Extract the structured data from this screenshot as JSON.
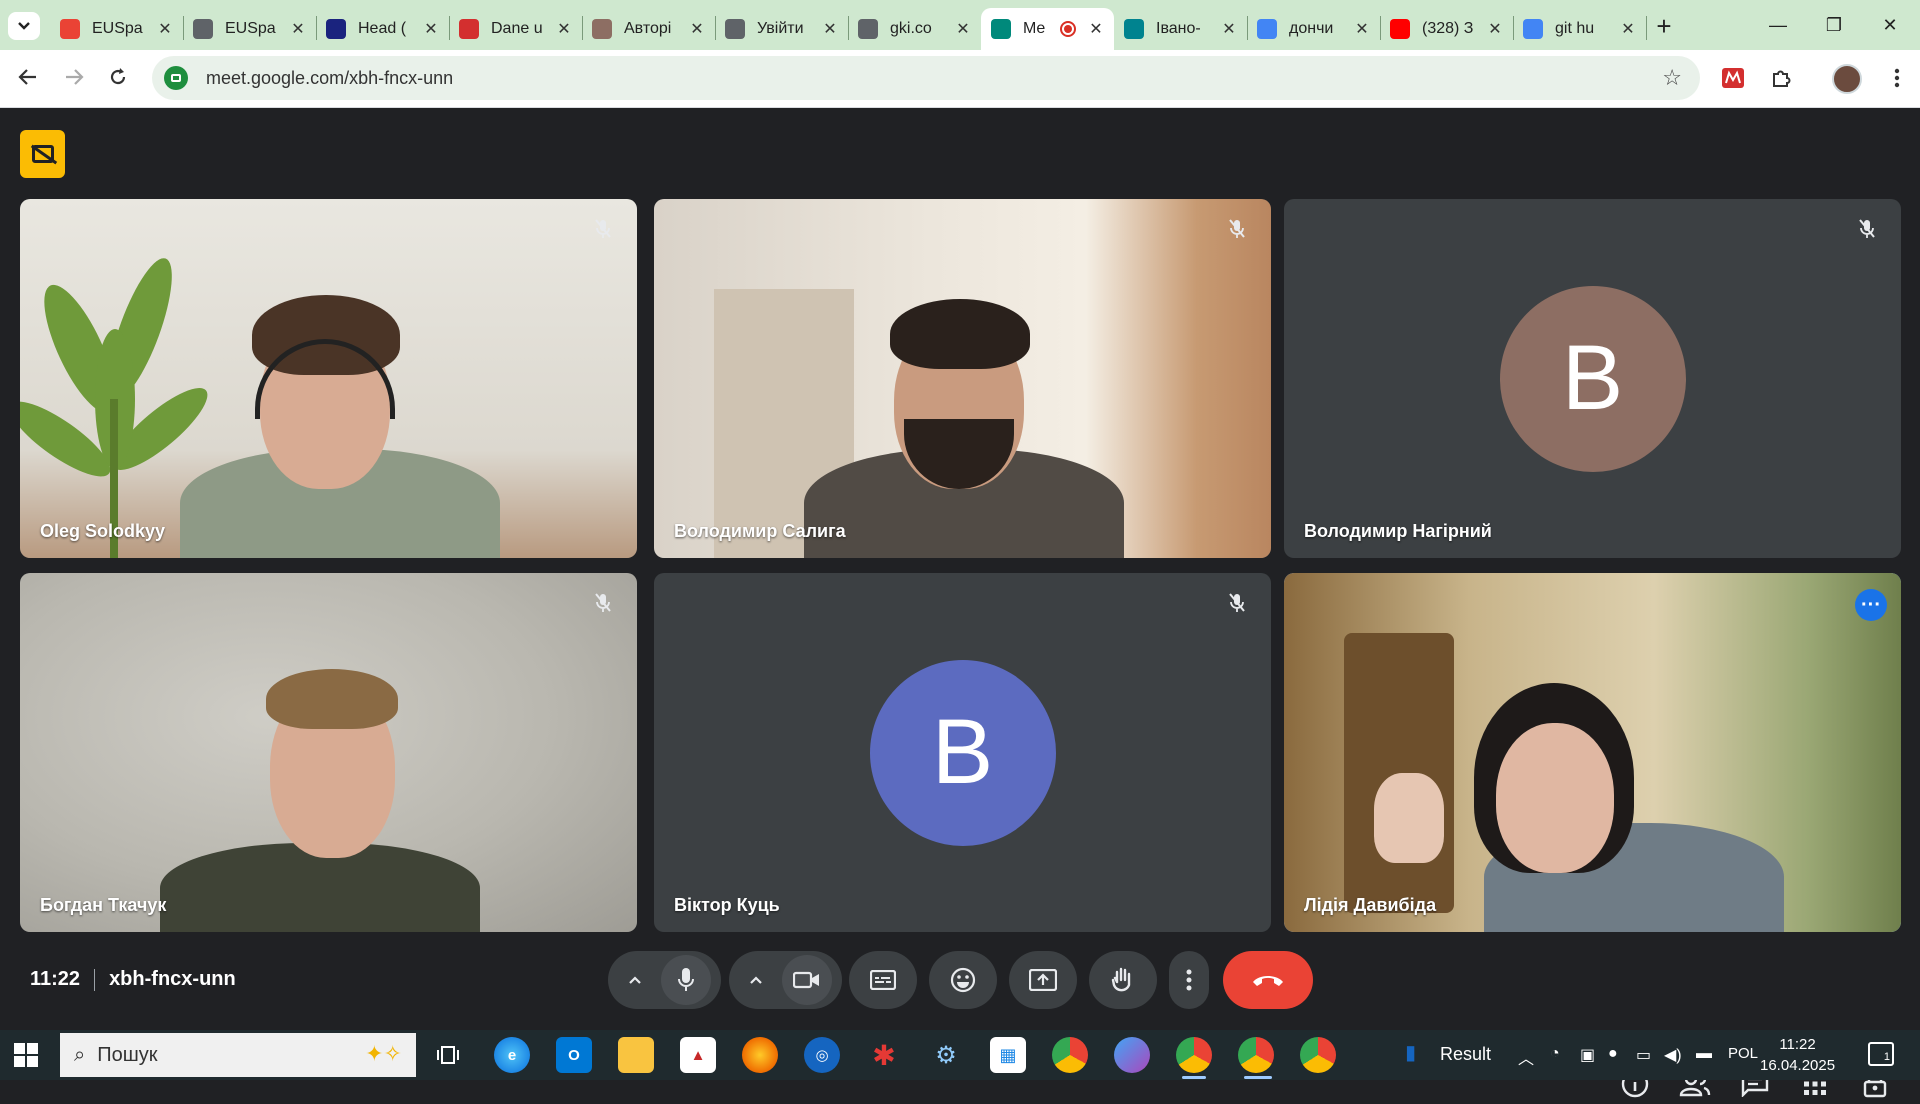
{
  "browser": {
    "tabs": [
      {
        "title": "EUSpa",
        "favicon": "gmail-icon",
        "color": "#ea4335",
        "active": false
      },
      {
        "title": "EUSpa",
        "favicon": "key-icon",
        "color": "#5f6368",
        "active": false
      },
      {
        "title": "Head (",
        "favicon": "star-icon",
        "color": "#1a237e",
        "active": false
      },
      {
        "title": "Dane u",
        "favicon": "gov-icon",
        "color": "#d32f2f",
        "active": false
      },
      {
        "title": "Авторі",
        "favicon": "seal-icon",
        "color": "#8d6e63",
        "active": false
      },
      {
        "title": "Увійти",
        "favicon": "globe-icon",
        "color": "#5f6368",
        "active": false
      },
      {
        "title": "gki.co",
        "favicon": "globe-icon",
        "color": "#5f6368",
        "active": false
      },
      {
        "title": "Me",
        "favicon": "meet-icon",
        "color": "#00897b",
        "active": true
      },
      {
        "title": "Івано-",
        "favicon": "tilda-icon",
        "color": "#00838f",
        "active": false
      },
      {
        "title": "дончи",
        "favicon": "google-icon",
        "color": "#4285f4",
        "active": false
      },
      {
        "title": "(328) З",
        "favicon": "youtube-icon",
        "color": "#ff0000",
        "active": false
      },
      {
        "title": "git hu",
        "favicon": "google-icon",
        "color": "#4285f4",
        "active": false
      }
    ],
    "tab_menu_icon": "chevron-down",
    "new_tab_symbol": "+",
    "url": "meet.google.com/xbh-fncx-unn",
    "window_controls": {
      "minimize": "—",
      "restore": "❐",
      "close": "✕"
    }
  },
  "meet": {
    "participants": [
      {
        "name": "Oleg Solodkyy",
        "type": "video",
        "muted": true
      },
      {
        "name": "Володимир Салига",
        "type": "video",
        "muted": true
      },
      {
        "name": "Володимир Нагірний",
        "type": "avatar",
        "initial": "В",
        "avatar_color": "#8d6e63",
        "muted": true
      },
      {
        "name": "Богдан Ткачук",
        "type": "video",
        "muted": true
      },
      {
        "name": "Віктор Куць",
        "type": "avatar",
        "initial": "B",
        "avatar_color": "#5c6bc0",
        "muted": true
      },
      {
        "name": "Лідія Давибіда",
        "type": "video",
        "muted": false,
        "speaking": true
      }
    ],
    "time": "11:22",
    "meeting_code": "xbh-fncx-unn",
    "people_count": "6",
    "colors": {
      "background": "#202124",
      "control": "#3c4043",
      "hangup": "#ea4335",
      "accent": "#8ab4f8"
    }
  },
  "taskbar": {
    "search_placeholder": "Пошук",
    "result_label": "Result",
    "language": "POL",
    "time": "11:22",
    "date": "16.04.2025",
    "notification_count": "1"
  }
}
